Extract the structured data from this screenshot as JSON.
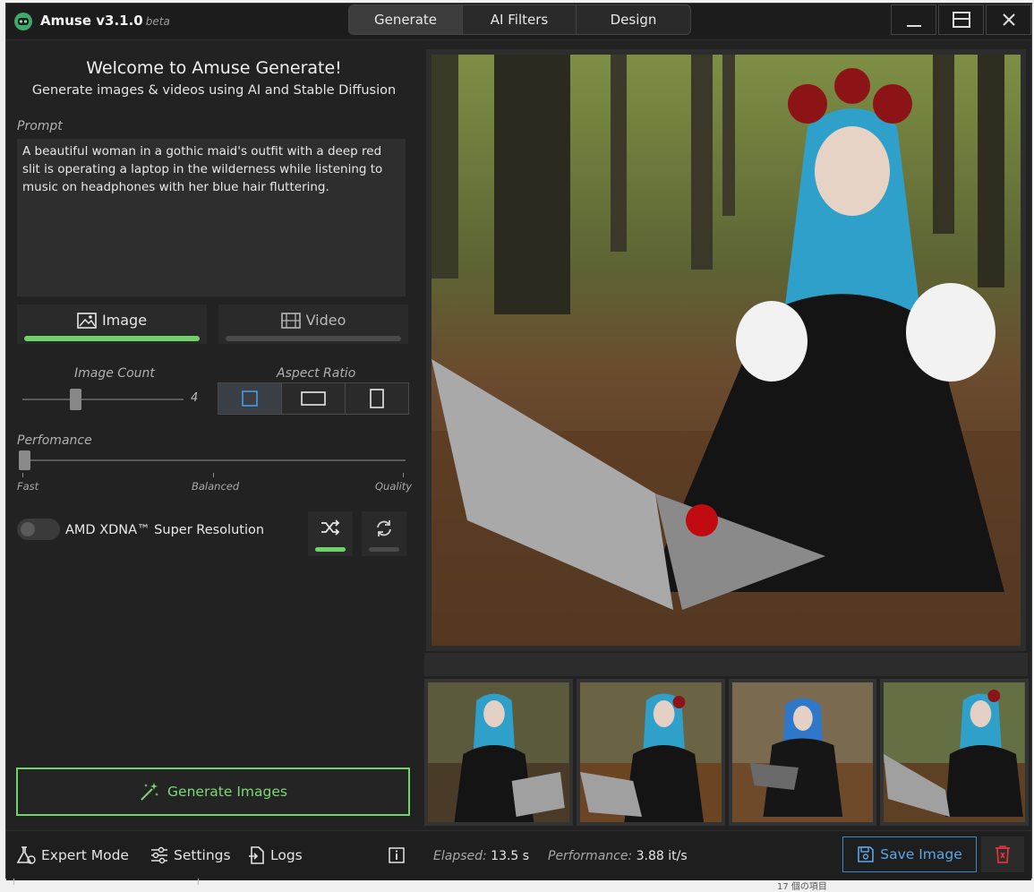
{
  "app": {
    "title": "Amuse v3.1.0",
    "badge": "beta"
  },
  "tabs": [
    {
      "label": "Generate",
      "active": true
    },
    {
      "label": "AI Filters",
      "active": false
    },
    {
      "label": "Design",
      "active": false
    }
  ],
  "window_controls": {
    "minimize_icon": "minimize-icon",
    "maximize_icon": "maximize-icon",
    "close_icon": "close-icon"
  },
  "welcome": {
    "title": "Welcome to Amuse Generate!",
    "subtitle": "Generate images & videos using AI and Stable Diffusion"
  },
  "prompt": {
    "label": "Prompt",
    "value": "A beautiful woman in a gothic maid's outfit with a deep red slit is operating a laptop in the wilderness while listening to music on headphones with her blue hair fluttering."
  },
  "mode": {
    "image_label": "Image",
    "video_label": "Video",
    "selected": "Image"
  },
  "image_count": {
    "label": "Image Count",
    "value": "4",
    "fraction": 0.33
  },
  "aspect_ratio": {
    "label": "Aspect Ratio",
    "options": [
      "square",
      "landscape",
      "portrait"
    ],
    "selected": "square"
  },
  "performance": {
    "label": "Perfomance",
    "ticks": [
      "Fast",
      "Balanced",
      "Quality"
    ],
    "fraction": 0.0
  },
  "super_resolution": {
    "label": "AMD XDNA™ Super Resolution",
    "enabled": false
  },
  "generate_button": {
    "label": "Generate Images"
  },
  "thumbnails_count": 4,
  "footer": {
    "expert_mode": "Expert Mode",
    "settings": "Settings",
    "logs": "Logs",
    "elapsed_label": "Elapsed:",
    "elapsed_value": "13.5 s",
    "performance_label": "Performance:",
    "performance_value": "3.88 it/s",
    "save_label": "Save Image"
  },
  "colors": {
    "accent_green": "#6fd36a",
    "accent_blue": "#3a87c9",
    "danger_red": "#e0353a"
  },
  "underlying_text": "17 個の項目"
}
